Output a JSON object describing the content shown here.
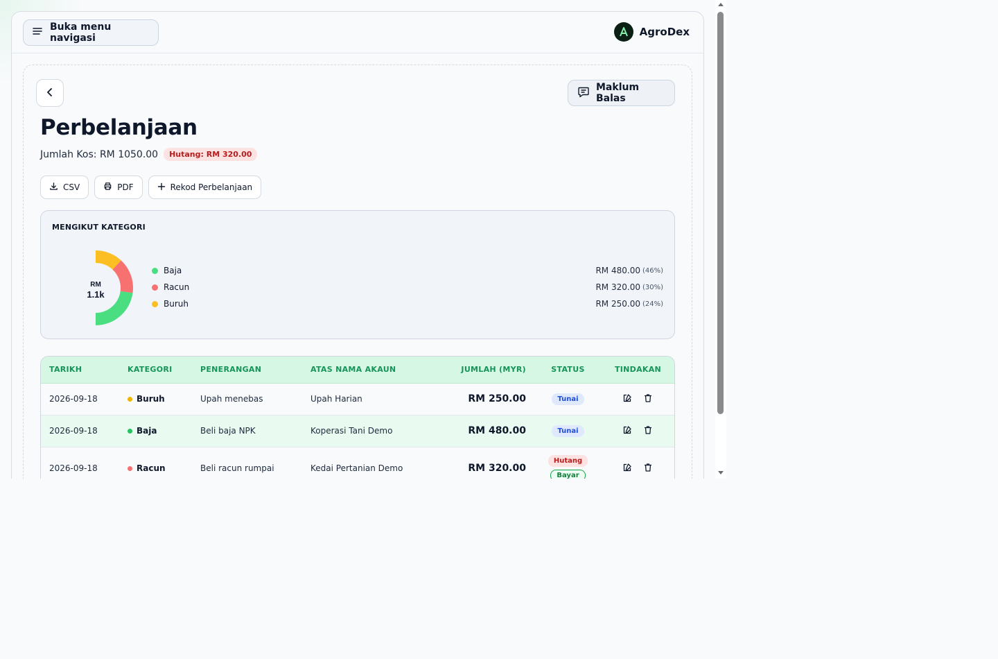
{
  "header": {
    "nav_button_label": "Buka menu navigasi",
    "brand_name": "AgroDex",
    "brand_initial": "A"
  },
  "page": {
    "feedback_label": "Maklum Balas",
    "title": "Perbelanjaan",
    "total_cost_text": "Jumlah Kos: RM 1050.00",
    "debt_badge": "Hutang: RM 320.00"
  },
  "actions": {
    "csv_label": "CSV",
    "pdf_label": "PDF",
    "add_label": "Rekod Perbelanjaan"
  },
  "category_panel": {
    "title": "MENGIKUT KATEGORI",
    "center_currency": "RM",
    "center_total": "1.1k",
    "items": [
      {
        "label": "Baja",
        "amount": "RM 480.00",
        "percent": "(46%)",
        "color": "#4ade80"
      },
      {
        "label": "Racun",
        "amount": "RM 320.00",
        "percent": "(30%)",
        "color": "#f87171"
      },
      {
        "label": "Buruh",
        "amount": "RM 250.00",
        "percent": "(24%)",
        "color": "#fbbf24"
      }
    ]
  },
  "chart_data": {
    "type": "pie",
    "categories": [
      "Baja",
      "Racun",
      "Buruh"
    ],
    "values": [
      480,
      320,
      250
    ],
    "percentages": [
      46,
      30,
      24
    ],
    "colors": [
      "#4ade80",
      "#f87171",
      "#fbbf24"
    ],
    "center_label": "RM 1.1k",
    "title": "MENGIKUT KATEGORI"
  },
  "table": {
    "headers": [
      "TARIKH",
      "KATEGORI",
      "PENERANGAN",
      "ATAS NAMA AKAUN",
      "JUMLAH (MYR)",
      "STATUS",
      "TINDAKAN"
    ],
    "rows": [
      {
        "date": "2026-09-18",
        "category": "Buruh",
        "category_color": "#f5b300",
        "description": "Upah menebas",
        "account": "Upah Harian",
        "amount": "RM 250.00",
        "status": "Tunai"
      },
      {
        "date": "2026-09-18",
        "category": "Baja",
        "category_color": "#22c55e",
        "description": "Beli baja NPK",
        "account": "Koperasi Tani Demo",
        "amount": "RM 480.00",
        "status": "Tunai"
      },
      {
        "date": "2026-09-18",
        "category": "Racun",
        "category_color": "#f87171",
        "description": "Beli racun rumpai",
        "account": "Kedai Pertanian Demo",
        "amount": "RM 320.00",
        "status": "Hutang",
        "pay_label": "Bayar"
      }
    ]
  }
}
